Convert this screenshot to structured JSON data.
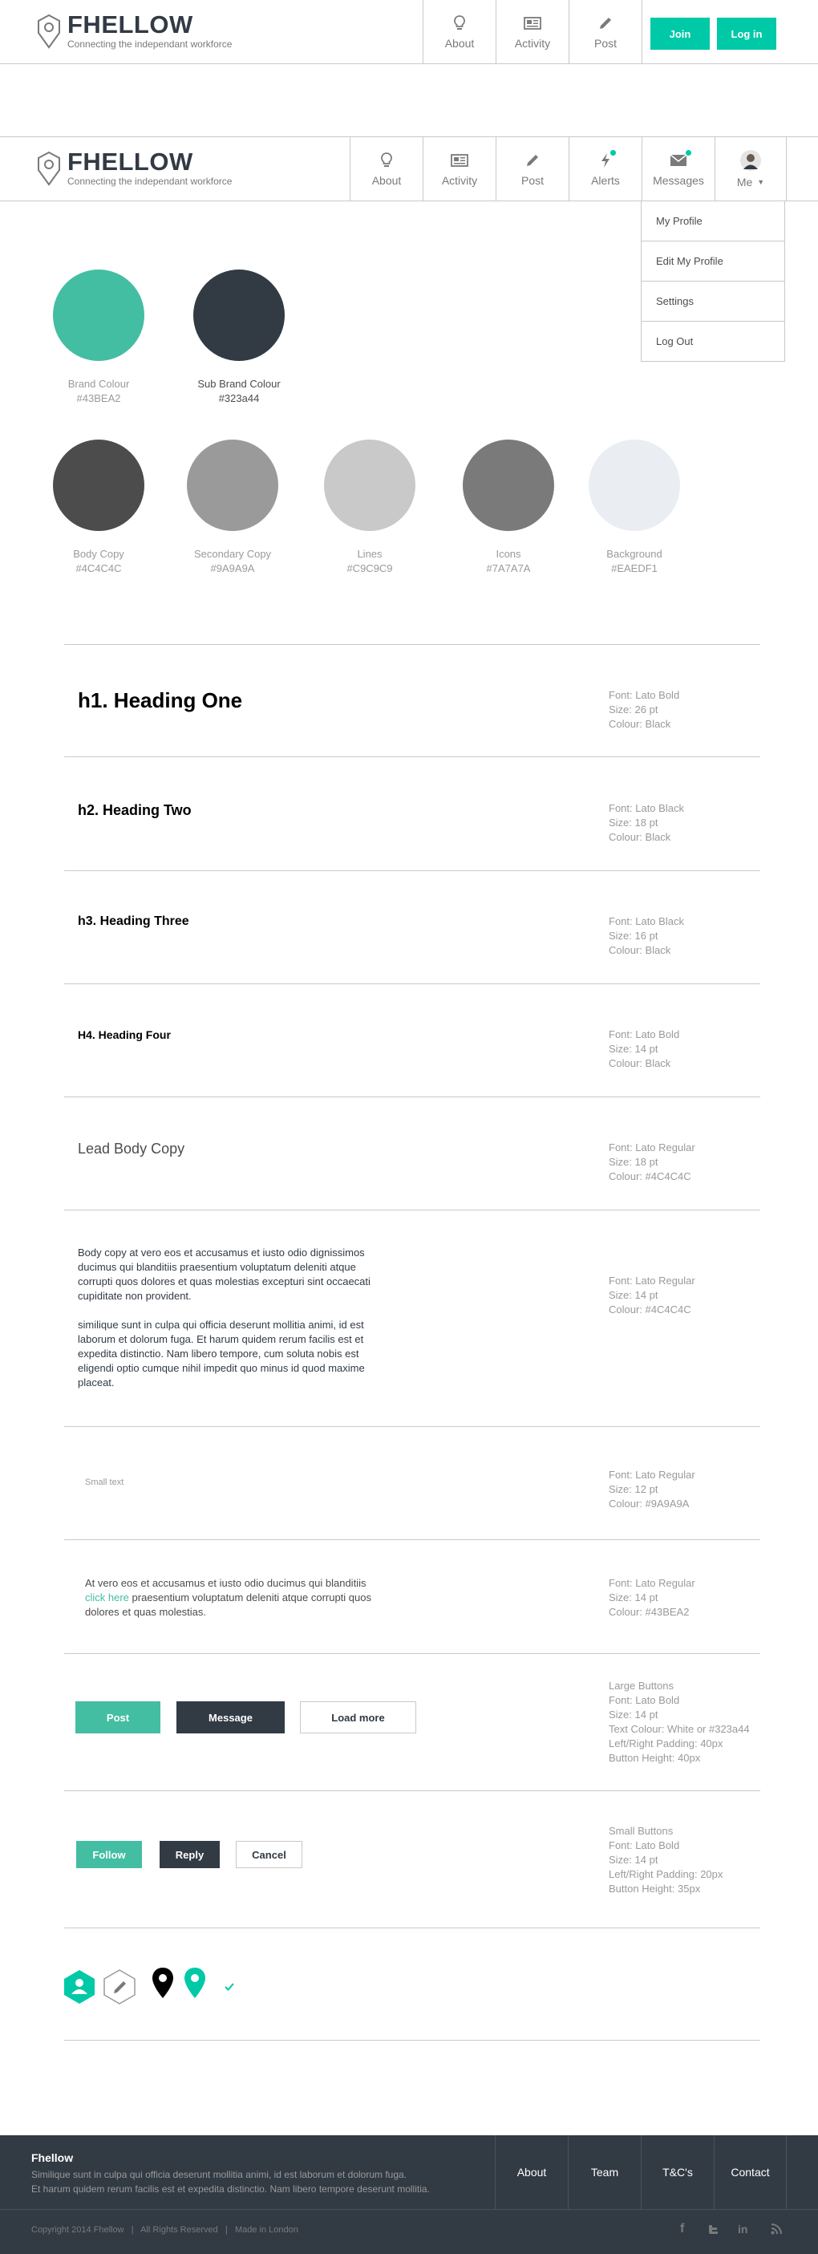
{
  "header1": {
    "logo_name": "FHELLOW",
    "tagline": "Connecting the independant workforce",
    "nav": [
      {
        "label": "About",
        "icon": "lightbulb-icon"
      },
      {
        "label": "Activity",
        "icon": "newspaper-icon"
      },
      {
        "label": "Post",
        "icon": "pencil-icon"
      }
    ],
    "join_label": "Join",
    "login_label": "Log in"
  },
  "header2": {
    "logo_name": "FHELLOW",
    "tagline": "Connecting the independant workforce",
    "nav": [
      {
        "label": "About",
        "icon": "lightbulb-icon"
      },
      {
        "label": "Activity",
        "icon": "newspaper-icon"
      },
      {
        "label": "Post",
        "icon": "pencil-icon"
      },
      {
        "label": "Alerts",
        "icon": "lightning-icon"
      },
      {
        "label": "Messages",
        "icon": "envelope-icon"
      }
    ],
    "me_label": "Me",
    "dropdown": [
      "My Profile",
      "Edit My Profile",
      "Settings",
      "Log Out"
    ]
  },
  "swatches": [
    {
      "name": "Brand Colour",
      "hex": "#43BEA2",
      "color": "#43BEA2"
    },
    {
      "name": "Sub Brand Colour",
      "hex": "#323a44",
      "color": "#323a44"
    },
    {
      "name": "Body Copy",
      "hex": "#4C4C4C",
      "color": "#4C4C4C"
    },
    {
      "name": "Secondary Copy",
      "hex": "#9A9A9A",
      "color": "#9A9A9A"
    },
    {
      "name": "Lines",
      "hex": "#C9C9C9",
      "color": "#C9C9C9"
    },
    {
      "name": "Icons",
      "hex": "#7A7A7A",
      "color": "#7A7A7A"
    },
    {
      "name": "Background",
      "hex": "#EAEDF1",
      "color": "#EAEDF1"
    }
  ],
  "type": {
    "h1": {
      "sample": "h1. Heading One",
      "spec": [
        "Font: Lato Bold",
        "Size: 26 pt",
        "Colour: Black"
      ]
    },
    "h2": {
      "sample": "h2. Heading Two",
      "spec": [
        "Font: Lato Black",
        "Size: 18 pt",
        "Colour: Black"
      ]
    },
    "h3": {
      "sample": "h3. Heading Three",
      "spec": [
        "Font: Lato Black",
        "Size: 16 pt",
        "Colour: Black"
      ]
    },
    "h4": {
      "sample": "H4. Heading Four",
      "spec": [
        "Font: Lato Bold",
        "Size: 14 pt",
        "Colour: Black"
      ]
    },
    "lead": {
      "sample": "Lead Body Copy",
      "spec": [
        "Font: Lato Regular",
        "Size: 18 pt",
        "Colour: #4C4C4C"
      ]
    },
    "body": {
      "p1": "Body copy at vero eos et accusamus et iusto odio dignissimos ducimus qui blanditiis praesentium voluptatum deleniti atque corrupti quos dolores et quas molestias excepturi sint occaecati cupiditate non provident.",
      "p2": "similique sunt in culpa qui officia deserunt mollitia animi, id est laborum et dolorum fuga. Et harum quidem rerum facilis est et expedita distinctio. Nam libero tempore, cum soluta nobis est eligendi optio cumque nihil impedit quo minus id quod maxime placeat.",
      "spec": [
        "Font: Lato Regular",
        "Size: 14 pt",
        "Colour: #4C4C4C"
      ]
    },
    "small": {
      "sample": "Small text",
      "spec": [
        "Font: Lato Regular",
        "Size: 12 pt",
        "Colour: #9A9A9A"
      ]
    },
    "link": {
      "before": "At vero eos et accusamus et iusto odio  ducimus qui blanditiis ",
      "link": "click here",
      "after": " praesentium voluptatum deleniti atque corrupti quos dolores et quas molestias.",
      "spec": [
        "Font: Lato Regular",
        "Size: 14 pt",
        "Colour: #43BEA2"
      ]
    }
  },
  "buttons_large": {
    "post": "Post",
    "message": "Message",
    "load_more": "Load more",
    "spec": [
      "Large Buttons",
      "Font: Lato Bold",
      "Size: 14 pt",
      "Text Colour: White or #323a44",
      "Left/Right Padding: 40px",
      "Button Height: 40px"
    ]
  },
  "buttons_small": {
    "follow": "Follow",
    "reply": "Reply",
    "cancel": "Cancel",
    "spec": [
      "Small Buttons",
      "Font: Lato Bold",
      "Size: 14 pt",
      "Left/Right Padding: 20px",
      "Button Height: 35px"
    ]
  },
  "footer": {
    "title": "Fhellow",
    "line1": "Similique sunt in culpa qui officia deserunt mollitia animi, id est laborum et dolorum fuga.",
    "line2": "Et harum quidem rerum facilis est et expedita distinctio. Nam libero tempore deserunt mollitia.",
    "links": [
      "About",
      "Team",
      "T&C's",
      "Contact"
    ],
    "copyright": "Copyright 2014 Fhellow   |   All Rights Reserved   |   Made in London",
    "social": [
      "facebook-icon",
      "twitter-icon",
      "linkedin-icon",
      "rss-icon"
    ]
  }
}
